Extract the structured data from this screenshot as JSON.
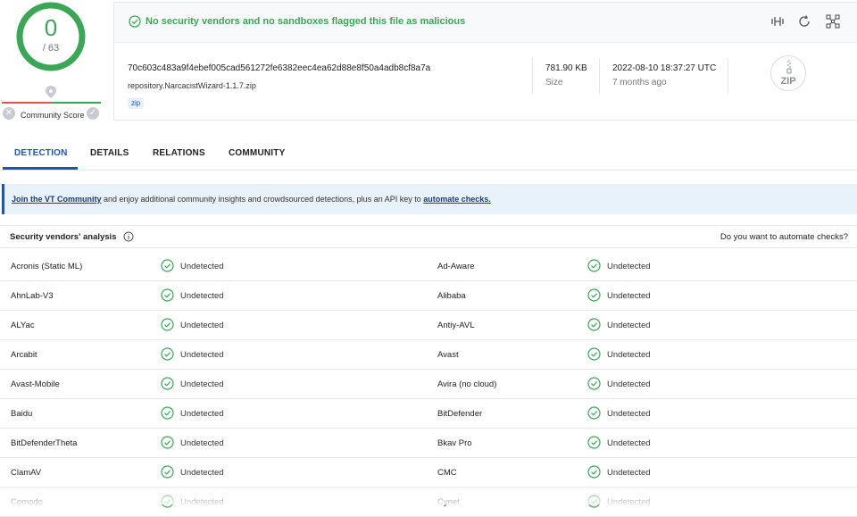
{
  "score": {
    "value": "0",
    "total": "/ 63",
    "community_label": "Community Score"
  },
  "banner": {
    "message": "No security vendors and no sandboxes flagged this file as malicious"
  },
  "file": {
    "hash": "70c603c483a9f4ebef005cad561272fe6382eec4ea62d88e8f50a4adb8cf8a7a",
    "name": "repository.NarcacistWizard-1.1.7.zip",
    "tag": "zip",
    "size": "781.90 KB",
    "size_label": "Size",
    "date": "2022-08-10 18:37:27 UTC",
    "date_relative": "7 months ago",
    "type_icon_label": "ZIP"
  },
  "tabs": [
    "DETECTION",
    "DETAILS",
    "RELATIONS",
    "COMMUNITY"
  ],
  "info": {
    "join_link": "Join the VT Community",
    "middle": " and enjoy additional community insights and crowdsourced detections, plus an API key to ",
    "automate_link": "automate checks."
  },
  "vendors": {
    "title": "Security vendors' analysis",
    "automate_question": "Do you want to automate checks?",
    "rows": [
      {
        "left": "Acronis (Static ML)",
        "left_result": "Undetected",
        "right": "Ad-Aware",
        "right_result": "Undetected"
      },
      {
        "left": "AhnLab-V3",
        "left_result": "Undetected",
        "right": "Alibaba",
        "right_result": "Undetected"
      },
      {
        "left": "ALYac",
        "left_result": "Undetected",
        "right": "Antiy-AVL",
        "right_result": "Undetected"
      },
      {
        "left": "Arcabit",
        "left_result": "Undetected",
        "right": "Avast",
        "right_result": "Undetected"
      },
      {
        "left": "Avast-Mobile",
        "left_result": "Undetected",
        "right": "Avira (no cloud)",
        "right_result": "Undetected"
      },
      {
        "left": "Baidu",
        "left_result": "Undetected",
        "right": "BitDefender",
        "right_result": "Undetected"
      },
      {
        "left": "BitDefenderTheta",
        "left_result": "Undetected",
        "right": "Bkav Pro",
        "right_result": "Undetected"
      },
      {
        "left": "ClamAV",
        "left_result": "Undetected",
        "right": "CMC",
        "right_result": "Undetected"
      },
      {
        "left": "Comodo",
        "left_result": "Undetected",
        "right": "Cynet",
        "right_result": "Undetected"
      }
    ]
  },
  "colors": {
    "accent": "#1a56b8",
    "ok": "#3aa757",
    "bad": "#e0524d"
  }
}
